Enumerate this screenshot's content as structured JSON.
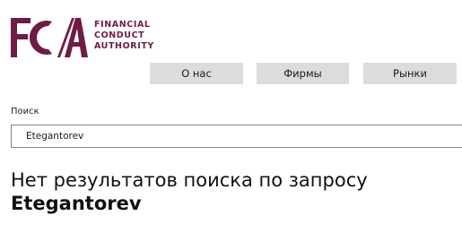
{
  "brand": {
    "mark": "FCA",
    "name_lines": [
      "FINANCIAL",
      "CONDUCT",
      "AUTHORITY"
    ],
    "color": "#701b45"
  },
  "nav": {
    "items": [
      {
        "label": "О нас"
      },
      {
        "label": "Фирмы"
      },
      {
        "label": "Рынки"
      }
    ]
  },
  "search": {
    "label": "Поиск",
    "value": "Etegantorev"
  },
  "result": {
    "message": "Нет результатов поиска по запросу",
    "query": "Etegantorev"
  }
}
